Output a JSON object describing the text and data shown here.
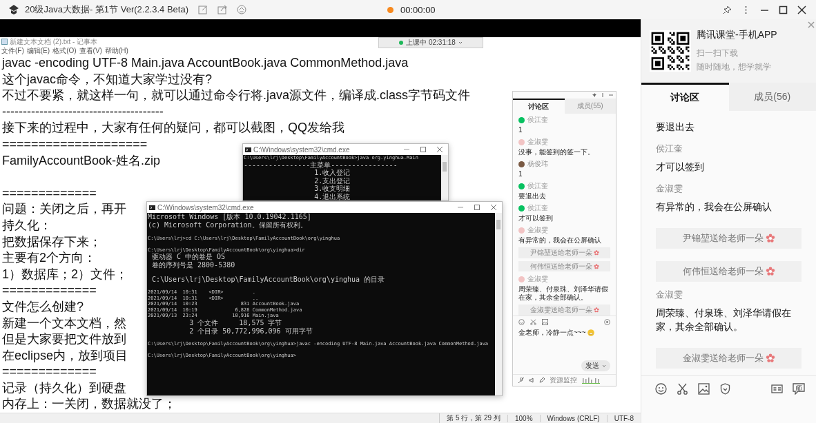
{
  "window": {
    "title": "20级Java大数据- 第1节 Ver(2.2.3.4 Beta)",
    "timer": "00:00:00"
  },
  "shared_screen": {
    "class_status": {
      "label": "上课中 02:31:18"
    },
    "notepad": {
      "title": "新建文本文档 (2).txt - 记事本",
      "menu": [
        "文件(F)",
        "编辑(E)",
        "格式(O)",
        "查看(V)",
        "帮助(H)"
      ],
      "blocks": [
        [
          "javac -encoding UTF-8 Main.java AccountBook.java CommonMethod.java",
          "这个javac命令，不知道大家学过没有?",
          "不过不要紧，就这样一句，就可以通过命令行将.java源文件，编译成.class字节码文件",
          "---------------------------------------",
          "接下来的过程中，大家有任何的疑问，都可以截图，QQ发给我",
          "====================",
          "FamilyAccountBook-姓名.zip"
        ],
        [
          "=============",
          "问题：关闭之后，再开",
          "持久化：",
          "把数据保存下来；",
          "主要有2个方向：",
          "1）数据库；2）文件；",
          "=============",
          "文件怎么创建?",
          "新建一个文本文档，然",
          "但是大家要把文件放到",
          "在eclipse内，放到项目",
          "=============",
          "记录（持久化）到硬盘",
          "内存上：一关闭，数据就没了；"
        ]
      ],
      "status_bar": [
        "第 5 行，第 29 列",
        "100%",
        "Windows (CRLF)",
        "UTF-8"
      ]
    },
    "cmd_windows": [
      {
        "title": "C:\\Windows\\system32\\cmd.exe",
        "blocks": [
          [
            "C:\\Users\\lrj\\Desktop\\FamilyAccountBook>java org.yinghua.Main",
            "----------------主菜单----------------",
            "                 1.收入登记",
            "                 2.支出登记",
            "                 3.收支明细",
            "                 4.退出系统"
          ]
        ]
      },
      {
        "title": "C:\\Windows\\system32\\cmd.exe",
        "blocks": [
          [
            "Microsoft Windows [版本 10.0.19042.1165]",
            "(c) Microsoft Corporation。保留所有权利。"
          ],
          [
            "C:\\Users\\lrj>cd C:\\Users\\lrj\\Desktop\\FamilyAccountBook\\org\\yinghua"
          ],
          [
            "C:\\Users\\lrj\\Desktop\\FamilyAccountBook\\org\\yinghua>dir",
            " 驱动器 C 中的卷是 OS",
            " 卷的序列号是 2800-5380"
          ],
          [
            " C:\\Users\\lrj\\Desktop\\FamilyAccountBook\\org\\yinghua 的目录"
          ],
          [
            "2021/09/14  10:31    <DIR>          .",
            "2021/09/14  10:31    <DIR>          ..",
            "2021/09/14  10:23               831 AccountBook.java",
            "2021/09/14  10:19             6,828 CommonMethod.java",
            "2021/09/13  23:24            10,916 Main.java",
            "          3 个文件     18,575 字节",
            "          2 个目录 50,772,996,096 可用字节"
          ],
          [
            "C:\\Users\\lrj\\Desktop\\FamilyAccountBook\\org\\yinghua>javac -encoding UTF-8 Main.java AccountBook.java CommonMethod.java"
          ],
          [
            "C:\\Users\\lrj\\Desktop\\FamilyAccountBook\\org\\yinghua>"
          ]
        ]
      }
    ],
    "chat_window": {
      "tabs": [
        {
          "label": "讨论区",
          "selected": true
        },
        {
          "label": "成员(55)",
          "selected": false
        }
      ],
      "messages": [
        {
          "kind": "message",
          "name": "侯江奎",
          "text": "1",
          "color": "#07c160"
        },
        {
          "kind": "message",
          "name": "金淑雯",
          "text": "没事，能签到的签一下。",
          "color": "#f2c4c4"
        },
        {
          "kind": "message",
          "name": "杨俊玮",
          "text": "1",
          "color": "#7a5a44"
        },
        {
          "kind": "message",
          "name": "侯江奎",
          "text": "要退出去",
          "color": "#07c160"
        },
        {
          "kind": "message",
          "name": "侯江奎",
          "text": "才可以签到",
          "color": "#07c160"
        },
        {
          "kind": "message",
          "name": "金淑雯",
          "text": "有异常的，我会在公屏确认",
          "color": "#f2c4c4"
        },
        {
          "kind": "gift",
          "text": "尹锦堃送给老师一朵"
        },
        {
          "kind": "gift",
          "text": "何伟恒送给老师一朵"
        },
        {
          "kind": "message",
          "name": "金淑雯",
          "text": "周荣臻、付泉珠、刘泽华请假在家，其余全部确认。",
          "color": "#f2c4c4"
        },
        {
          "kind": "gift",
          "text": "金淑雯送给老师一朵"
        }
      ],
      "input": {
        "value": "金老师，冷静一点~~~"
      },
      "send": "发送",
      "monitor": "资源监控"
    }
  },
  "app_promo": {
    "title": "腾讯课堂-手机APP",
    "subtitle": "扫一扫下载",
    "tagline": "随时随地，想学就学"
  },
  "tabs": [
    {
      "label": "讨论区",
      "selected": true
    },
    {
      "label": "成员(56)",
      "selected": false
    }
  ],
  "messages": [
    {
      "kind": "message",
      "text": "要退出去"
    },
    {
      "kind": "message",
      "name": "侯江奎",
      "text": "才可以签到"
    },
    {
      "kind": "message",
      "name": "金淑雯",
      "text": "有异常的，我会在公屏确认"
    },
    {
      "kind": "gift",
      "text": "尹锦堃送给老师一朵"
    },
    {
      "kind": "gift",
      "text": "何伟恒送给老师一朵"
    },
    {
      "kind": "message",
      "name": "金淑雯",
      "text": "周荣臻、付泉珠、刘泽华请假在家，其余全部确认。"
    },
    {
      "kind": "gift",
      "text": "金淑雯送给老师一朵"
    }
  ],
  "teacher_chat": {
    "label": "师"
  }
}
